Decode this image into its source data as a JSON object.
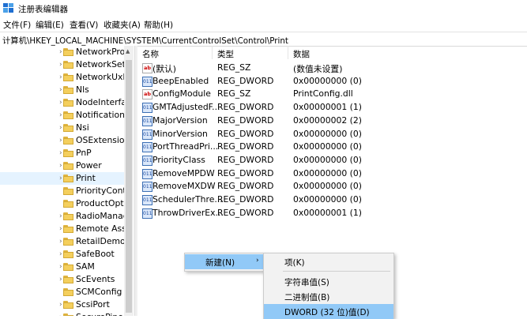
{
  "window": {
    "title": "注册表编辑器",
    "icon": "regedit-icon"
  },
  "menu": [
    "文件(F)",
    "编辑(E)",
    "查看(V)",
    "收藏夹(A)",
    "帮助(H)"
  ],
  "address": "计算机\\HKEY_LOCAL_MACHINE\\SYSTEM\\CurrentControlSet\\Control\\Print",
  "tree": [
    {
      "label": "NetworkProv",
      "expandable": true
    },
    {
      "label": "NetworkSetu",
      "expandable": true
    },
    {
      "label": "NetworkUxM",
      "expandable": true
    },
    {
      "label": "Nls",
      "expandable": true
    },
    {
      "label": "NodeInterfac",
      "expandable": true
    },
    {
      "label": "Notifications",
      "expandable": true
    },
    {
      "label": "Nsi",
      "expandable": true
    },
    {
      "label": "OSExtensionI",
      "expandable": true
    },
    {
      "label": "PnP",
      "expandable": true
    },
    {
      "label": "Power",
      "expandable": true
    },
    {
      "label": "Print",
      "expandable": true,
      "selected": true
    },
    {
      "label": "PriorityContr",
      "expandable": false
    },
    {
      "label": "ProductOptic",
      "expandable": false
    },
    {
      "label": "RadioManag",
      "expandable": true
    },
    {
      "label": "Remote Assis",
      "expandable": true
    },
    {
      "label": "RetailDemo",
      "expandable": true
    },
    {
      "label": "SafeBoot",
      "expandable": true
    },
    {
      "label": "SAM",
      "expandable": true
    },
    {
      "label": "ScEvents",
      "expandable": true
    },
    {
      "label": "SCMConfig",
      "expandable": false
    },
    {
      "label": "ScsiPort",
      "expandable": true
    },
    {
      "label": "SecurePipe",
      "expandable": true
    }
  ],
  "columns": {
    "name": "名称",
    "type": "类型",
    "data": "数据"
  },
  "values": [
    {
      "name": "(默认)",
      "type": "REG_SZ",
      "data": "(数值未设置)",
      "kind": "sz"
    },
    {
      "name": "BeepEnabled",
      "type": "REG_DWORD",
      "data": "0x00000000 (0)",
      "kind": "dw"
    },
    {
      "name": "ConfigModule",
      "type": "REG_SZ",
      "data": "PrintConfig.dll",
      "kind": "sz"
    },
    {
      "name": "GMTAdjustedF...",
      "type": "REG_DWORD",
      "data": "0x00000001 (1)",
      "kind": "dw"
    },
    {
      "name": "MajorVersion",
      "type": "REG_DWORD",
      "data": "0x00000002 (2)",
      "kind": "dw"
    },
    {
      "name": "MinorVersion",
      "type": "REG_DWORD",
      "data": "0x00000000 (0)",
      "kind": "dw"
    },
    {
      "name": "PortThreadPri...",
      "type": "REG_DWORD",
      "data": "0x00000000 (0)",
      "kind": "dw"
    },
    {
      "name": "PriorityClass",
      "type": "REG_DWORD",
      "data": "0x00000000 (0)",
      "kind": "dw"
    },
    {
      "name": "RemoveMPDW",
      "type": "REG_DWORD",
      "data": "0x00000000 (0)",
      "kind": "dw"
    },
    {
      "name": "RemoveMXDW",
      "type": "REG_DWORD",
      "data": "0x00000000 (0)",
      "kind": "dw"
    },
    {
      "name": "SchedulerThre...",
      "type": "REG_DWORD",
      "data": "0x00000000 (0)",
      "kind": "dw"
    },
    {
      "name": "ThrowDriverEx...",
      "type": "REG_DWORD",
      "data": "0x00000001 (1)",
      "kind": "dw"
    }
  ],
  "icon_text": {
    "sz": "ab",
    "dw": "011"
  },
  "context_menu": {
    "new_label": "新建(N)",
    "arrow": "›"
  },
  "submenu": [
    {
      "label": "项(K)"
    },
    {
      "sep": true
    },
    {
      "label": "字符串值(S)"
    },
    {
      "label": "二进制值(B)"
    },
    {
      "label": "DWORD (32 位)值(D)",
      "highlight": true
    }
  ],
  "colors": {
    "selection": "#e5f3ff",
    "highlight": "#91c9f7",
    "folder": "#f4cf5d"
  }
}
